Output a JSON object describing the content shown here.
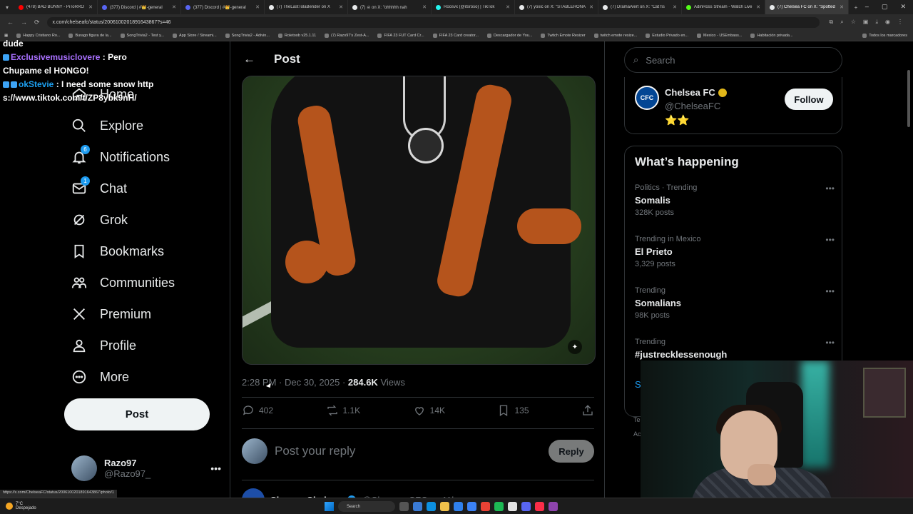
{
  "browser": {
    "tabs": [
      {
        "title": "(478) BAD BUNNY - PiToRRO",
        "color": "#ff0000"
      },
      {
        "title": "(377) Discord | #👑-general",
        "color": "#5865f2"
      },
      {
        "title": "(377) Discord | #👑-general",
        "color": "#5865f2"
      },
      {
        "title": "(7) TheLastTolaBender on X",
        "color": "#e7e9ea"
      },
      {
        "title": "(7) ☠ on X: \"ohhhhh nah",
        "color": "#e7e9ea"
      },
      {
        "title": "Roosvx (@itsroso) | TikTok",
        "color": "#25f4ee"
      },
      {
        "title": "(7) yoxic on X: \"STABLERONA",
        "color": "#e7e9ea"
      },
      {
        "title": "(7) DramaAlert on X: \"Cat fis",
        "color": "#e7e9ea"
      },
      {
        "title": "AdinRoss Stream - Watch Live",
        "color": "#53fc18"
      },
      {
        "title": "(7) Chelsea FC on X: \"Spotted",
        "color": "#e7e9ea",
        "active": true
      }
    ],
    "url": "x.com/chelseafc/status/2006100201891643867?s=46",
    "status_url": "https://x.com/ChelseaFC/status/2006100201891643867/photo/1",
    "bookmarks": [
      "Happy Cristiano Ro...",
      "Burago figura de la...",
      "SongTrivia2 - Test y...",
      "App Store / Streami...",
      "SongTrivia2 - Adivin...",
      "Roletoob v25.1.11",
      "(7) Razo97's Zest-A...",
      "FIFA 23 FUT Card Cr...",
      "FIFA 23 Card creator...",
      "Descargador de You...",
      "Twitch Emote Resizer",
      "twitch emote resize...",
      "Estudio Privado en...",
      "Mexico - USEmbass...",
      "Habitación privada..."
    ],
    "bookmarks_all": "Todos los marcadores"
  },
  "chat": [
    {
      "user": "dude",
      "msg": ""
    },
    {
      "user": "Exclusivemusiclovere",
      "msg": ": Pero Chupame el HONGO!"
    },
    {
      "user": "okStevie",
      "msg": ": I need some snow https://www.tiktok.com/t/ZP8ybk9nH/"
    }
  ],
  "nav": {
    "items": [
      {
        "label": "Home",
        "icon": "home-icon"
      },
      {
        "label": "Explore",
        "icon": "search-icon"
      },
      {
        "label": "Notifications",
        "icon": "bell-icon",
        "badge": "6"
      },
      {
        "label": "Chat",
        "icon": "mail-icon",
        "badge": "1"
      },
      {
        "label": "Grok",
        "icon": "grok-icon"
      },
      {
        "label": "Bookmarks",
        "icon": "bookmark-icon"
      },
      {
        "label": "Communities",
        "icon": "communities-icon"
      },
      {
        "label": "Premium",
        "icon": "x-logo-icon"
      },
      {
        "label": "Profile",
        "icon": "person-icon"
      },
      {
        "label": "More",
        "icon": "more-icon"
      }
    ],
    "post_label": "Post",
    "account": {
      "name": "Razo97",
      "handle": "@Razo97_"
    }
  },
  "main": {
    "header_title": "Post",
    "time": "2:28 PM",
    "date": "Dec 30, 2025",
    "views_count": "284.6K",
    "views_label": "Views",
    "actions": {
      "replies": "402",
      "reposts": "1.1K",
      "likes": "14K",
      "bookmarks": "135"
    },
    "reply_placeholder": "Post your reply",
    "reply_button": "Reply",
    "next_reply": {
      "name": "Sleeper Chelsea",
      "handle": "@Sleeper_CFC",
      "time": "11h"
    }
  },
  "right": {
    "search_placeholder": "Search",
    "profile_card": {
      "name": "Chelsea FC",
      "handle": "@ChelseaFC",
      "stars": "⭐⭐",
      "follow_label": "Follow"
    },
    "trends_title": "What’s happening",
    "trends": [
      {
        "category": "Politics · Trending",
        "title": "Somalis",
        "count": "328K posts"
      },
      {
        "category": "Trending in Mexico",
        "title": "El Prieto",
        "count": "3,329 posts"
      },
      {
        "category": "Trending",
        "title": "Somalians",
        "count": "98K posts"
      },
      {
        "category": "Trending",
        "title": "#justrecklessenough",
        "count": ""
      }
    ],
    "show_more": "S",
    "footer": [
      "Te",
      "Ac"
    ]
  },
  "taskbar": {
    "weather_temp": "7°C",
    "weather_desc": "Despejado",
    "search_label": "Search"
  }
}
